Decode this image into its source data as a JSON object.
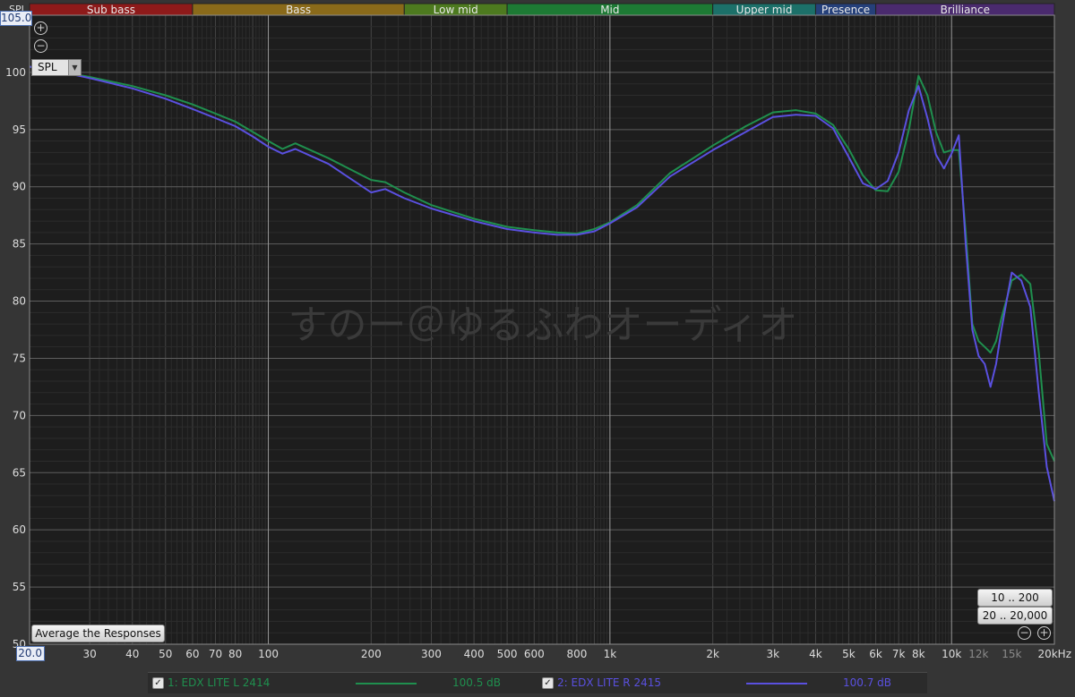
{
  "colors": {
    "green_series": "#1f8f4e",
    "blue_series": "#5a50e0",
    "grid_major": "#5e5e5e",
    "grid_minor": "#444444",
    "background": "#1d1d1d",
    "watermark": "#3a3a3a"
  },
  "bands": [
    {
      "label": "Sub bass",
      "color": "#8e1a1a"
    },
    {
      "label": "Bass",
      "color": "#8a6a1a"
    },
    {
      "label": "Low mid",
      "color": "#4d7a1f"
    },
    {
      "label": "Mid",
      "color": "#1d7a34"
    },
    {
      "label": "Upper mid",
      "color": "#1c7069"
    },
    {
      "label": "Presence",
      "color": "#25407a"
    },
    {
      "label": "Brilliance",
      "color": "#4a2a6e"
    }
  ],
  "chart_data": {
    "type": "line",
    "title": "",
    "xlabel": "",
    "ylabel": "SPL",
    "xscale": "log",
    "xlim": [
      20,
      20000
    ],
    "ylim": [
      50,
      105
    ],
    "yticks": [
      "100",
      "95",
      "90",
      "85",
      "80",
      "75",
      "70",
      "65",
      "60",
      "55",
      "50"
    ],
    "xticks": [
      "30",
      "40",
      "50",
      "60",
      "70",
      "80",
      "100",
      "200",
      "300",
      "400",
      "500",
      "600",
      "800",
      "1k",
      "2k",
      "3k",
      "4k",
      "5k",
      "6k",
      "7k",
      "8k",
      "10k",
      "12k",
      "15k",
      "20kHz"
    ],
    "grid": true,
    "watermark": "すのー＠ゆるふわオーディオ",
    "series": [
      {
        "name": "1: EDX LITE L 2414",
        "level": "100.5 dB",
        "color": "#1f8f4e",
        "x": [
          20,
          25,
          30,
          40,
          50,
          60,
          70,
          80,
          90,
          100,
          110,
          120,
          150,
          200,
          220,
          250,
          300,
          400,
          500,
          600,
          700,
          800,
          900,
          1000,
          1200,
          1500,
          2000,
          2500,
          3000,
          3500,
          4000,
          4500,
          5000,
          5500,
          6000,
          6500,
          7000,
          7500,
          8000,
          8500,
          9000,
          9500,
          10000,
          10500,
          11000,
          11500,
          12000,
          12500,
          13000,
          13500,
          14000,
          15000,
          16000,
          17000,
          18000,
          19000,
          20000
        ],
        "y": [
          100.5,
          100.0,
          99.6,
          98.8,
          98.0,
          97.2,
          96.4,
          95.7,
          94.8,
          94.0,
          93.3,
          93.8,
          92.5,
          90.6,
          90.4,
          89.5,
          88.4,
          87.2,
          86.5,
          86.2,
          86.0,
          85.9,
          86.3,
          86.9,
          88.4,
          91.2,
          93.6,
          95.3,
          96.5,
          96.7,
          96.4,
          95.4,
          93.3,
          91.0,
          89.7,
          89.6,
          91.3,
          95.0,
          99.7,
          98.0,
          94.8,
          93.0,
          93.2,
          93.2,
          86.0,
          78.0,
          76.5,
          76.0,
          75.5,
          76.5,
          78.5,
          81.8,
          82.3,
          81.5,
          75.5,
          67.5,
          66.0
        ]
      },
      {
        "name": "2: EDX LITE R 2415",
        "level": "100.7 dB",
        "color": "#5a50e0",
        "x": [
          20,
          25,
          30,
          40,
          50,
          60,
          70,
          80,
          90,
          100,
          110,
          120,
          150,
          200,
          220,
          250,
          300,
          400,
          500,
          600,
          700,
          800,
          900,
          1000,
          1200,
          1500,
          2000,
          2500,
          3000,
          3500,
          4000,
          4500,
          5000,
          5500,
          6000,
          6500,
          7000,
          7500,
          8000,
          8500,
          9000,
          9500,
          10000,
          10500,
          11000,
          11500,
          12000,
          12500,
          13000,
          13500,
          14000,
          15000,
          16000,
          17000,
          18000,
          19000,
          20000
        ],
        "y": [
          100.5,
          100.0,
          99.5,
          98.6,
          97.7,
          96.8,
          96.0,
          95.3,
          94.4,
          93.5,
          92.9,
          93.3,
          92.0,
          89.5,
          89.8,
          89.0,
          88.1,
          87.0,
          86.3,
          86.0,
          85.8,
          85.8,
          86.1,
          86.8,
          88.2,
          90.9,
          93.2,
          94.8,
          96.1,
          96.3,
          96.2,
          95.1,
          92.6,
          90.3,
          89.8,
          90.5,
          93.0,
          96.7,
          98.8,
          96.0,
          92.8,
          91.6,
          92.9,
          94.5,
          85.0,
          77.5,
          75.2,
          74.5,
          72.5,
          74.5,
          77.5,
          82.5,
          81.8,
          79.5,
          72.0,
          65.5,
          62.5
        ]
      }
    ]
  },
  "ui": {
    "axis_label": "SPL",
    "top_value": "105.00",
    "bottom_value": "20.0",
    "y_selector": "SPL",
    "average_button": "Average the Responses",
    "range_buttons": [
      "10 .. 200",
      "20 .. 20,000"
    ],
    "zoom_in_icon": "zoom-in-icon",
    "zoom_out_icon": "zoom-out-icon"
  }
}
